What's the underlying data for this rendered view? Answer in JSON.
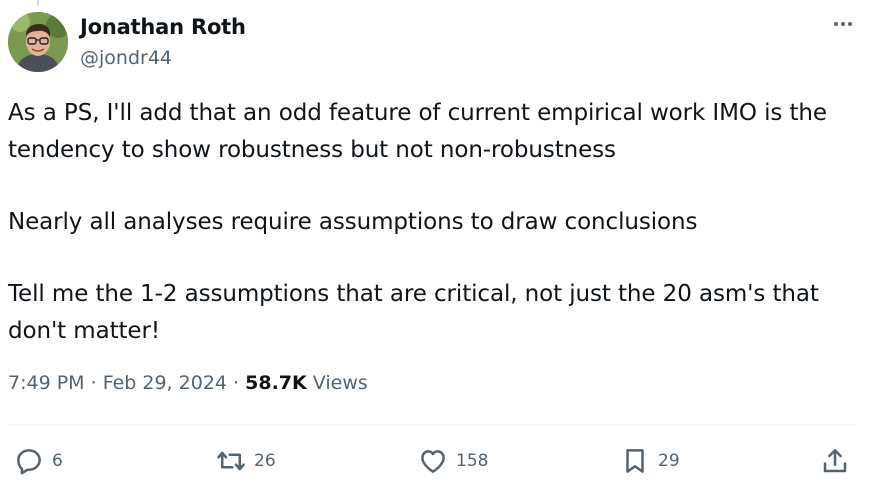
{
  "author": {
    "name": "Jonathan Roth",
    "handle": "@jondr44",
    "avatar_icon": "profile-photo"
  },
  "tweet": {
    "paragraphs": [
      "As a PS, I'll add that an odd feature of current empirical work IMO is the tendency to show robustness but not non-robustness",
      "Nearly all analyses require assumptions to draw conclusions",
      "Tell me the 1-2 assumptions that are critical, not just the 20 asm's that don't matter!"
    ]
  },
  "meta": {
    "time": "7:49 PM",
    "separator": "·",
    "date": "Feb 29, 2024",
    "views_count": "58.7K",
    "views_label": "Views"
  },
  "actions": {
    "replies": "6",
    "retweets": "26",
    "likes": "158",
    "bookmarks": "29"
  },
  "icons": {
    "more": "more-horizontal-icon",
    "reply": "reply-icon",
    "retweet": "retweet-icon",
    "like": "heart-icon",
    "bookmark": "bookmark-icon",
    "share": "share-icon"
  },
  "colors": {
    "text_primary": "#0f1419",
    "text_secondary": "#536471",
    "divider": "#eff3f4"
  }
}
